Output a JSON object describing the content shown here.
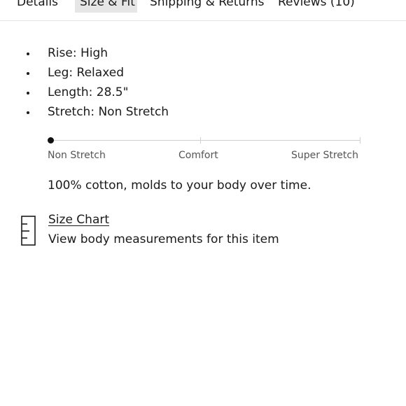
{
  "tabs": [
    {
      "label": "Details",
      "active": false
    },
    {
      "label": "Size & Fit",
      "active": true
    },
    {
      "label": "Shipping & Returns",
      "active": false
    },
    {
      "label": "Reviews (10)",
      "active": false
    }
  ],
  "specs": [
    "Rise: High",
    "Leg: Relaxed",
    "Length: 28.5\"",
    "Stretch: Non Stretch"
  ],
  "stretch_scale": {
    "labels": [
      "Non Stretch",
      "Comfort",
      "Super Stretch"
    ],
    "selected_level": "Non Stretch",
    "position_fraction": 0
  },
  "description": "100% cotton, molds to your body over time.",
  "size_chart": {
    "link_label": "Size Chart",
    "subtitle": "View body measurements for this item",
    "icon": "ruler-icon"
  }
}
